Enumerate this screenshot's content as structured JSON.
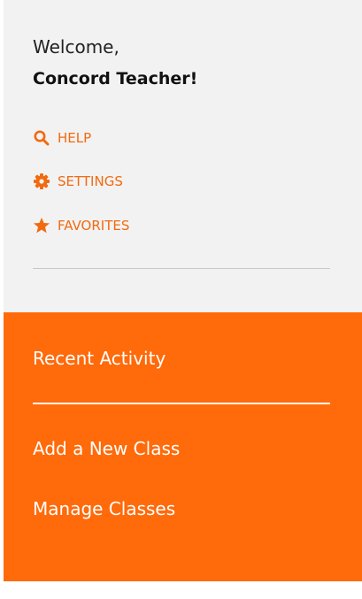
{
  "user": {
    "greeting": "Welcome,",
    "name": "Concord Teacher!"
  },
  "menu": {
    "help": {
      "label": "HELP",
      "icon": "search-icon"
    },
    "settings": {
      "label": "SETTINGS",
      "icon": "gear-icon"
    },
    "favorites": {
      "label": "FAVORITES",
      "icon": "star-icon"
    }
  },
  "nav": {
    "recent_activity": "Recent Activity",
    "add_class": "Add a New Class",
    "manage_classes": "Manage Classes"
  },
  "colors": {
    "accent": "#f26a10",
    "nav_background": "#ff6a0a",
    "panel_background": "#f2f2f2"
  }
}
